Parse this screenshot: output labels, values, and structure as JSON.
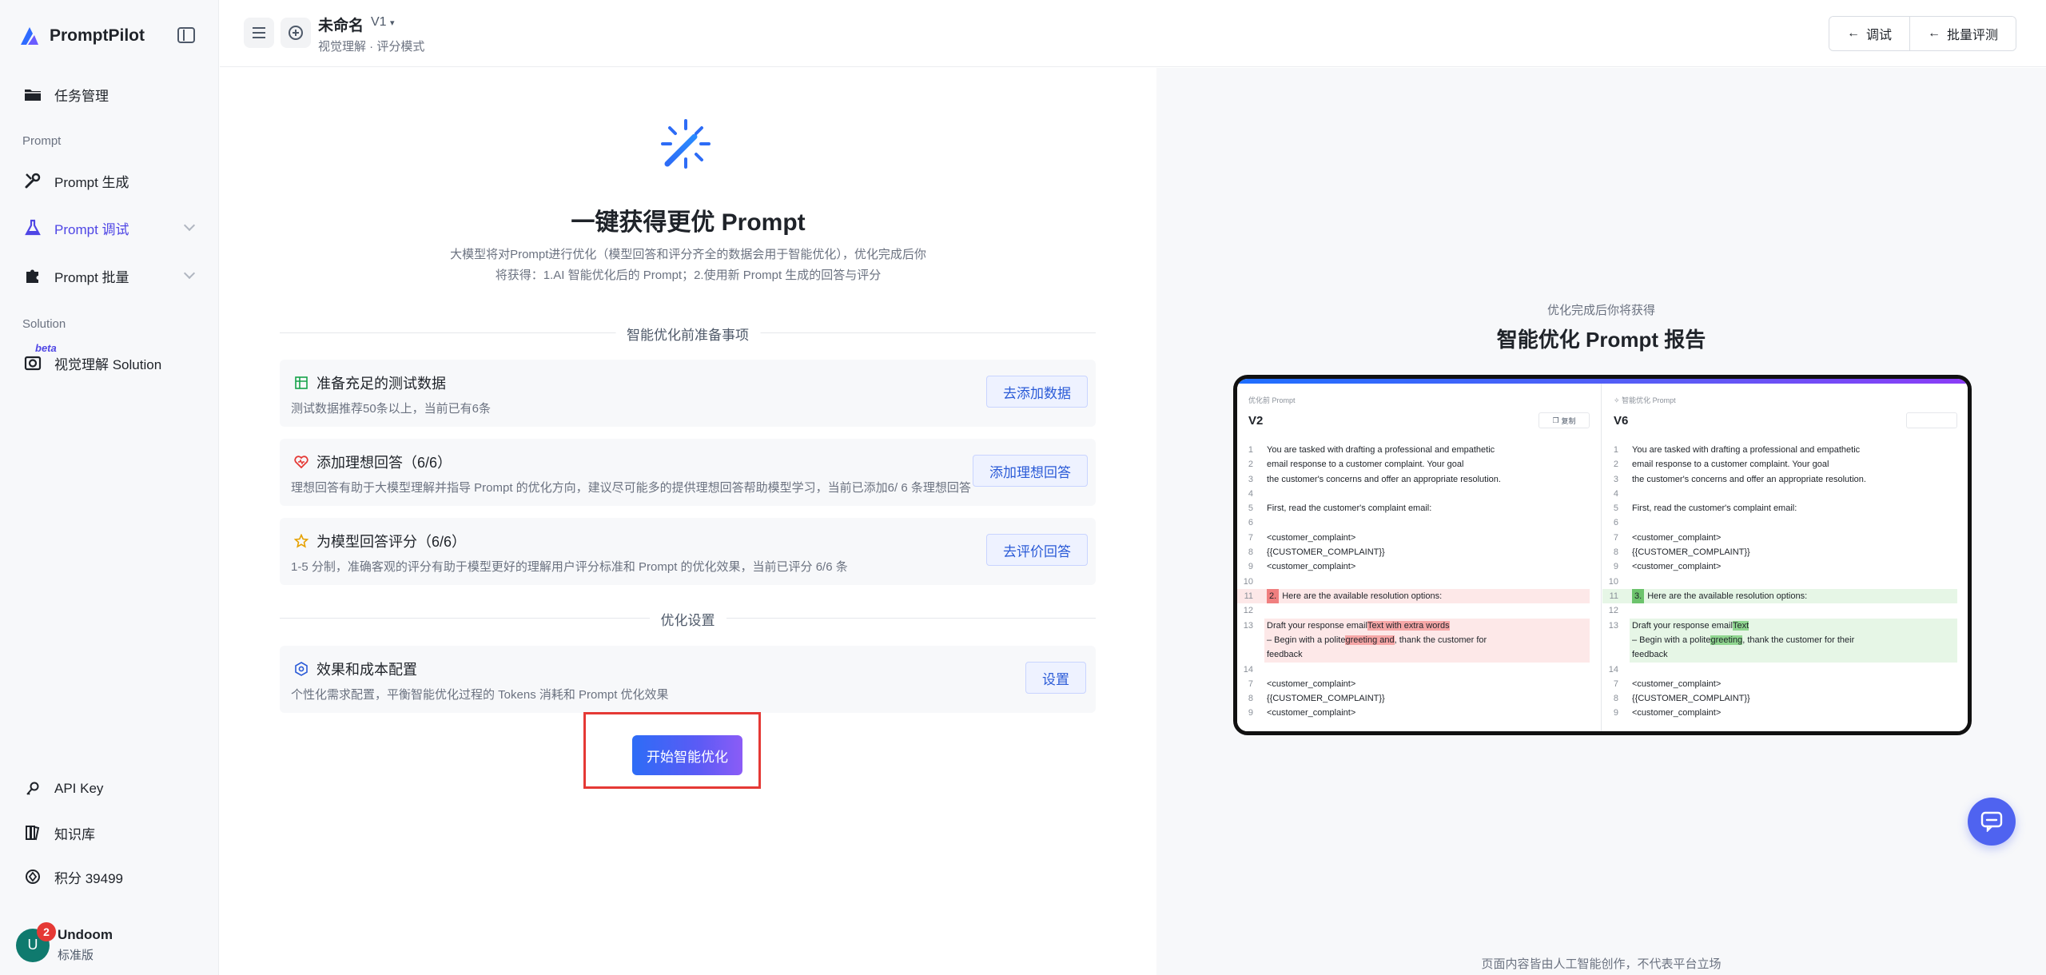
{
  "app": {
    "name": "PromptPilot"
  },
  "sidebar": {
    "items": [
      {
        "label": "任务管理"
      },
      {
        "label": "Prompt 生成"
      },
      {
        "label": "Prompt 调试"
      },
      {
        "label": "Prompt 批量"
      },
      {
        "label": "视觉理解 Solution"
      },
      {
        "label": "API Key"
      },
      {
        "label": "知识库"
      },
      {
        "label": "积分 39499"
      }
    ],
    "sections": {
      "prompt": "Prompt",
      "solution": "Solution"
    },
    "beta": "beta",
    "user": {
      "initial": "U",
      "badge": "2",
      "name": "Undoom",
      "plan": "标准版"
    }
  },
  "header": {
    "title": "未命名",
    "version": "V1",
    "subtitle": "视觉理解 · 评分模式",
    "buttons": {
      "debug": "调试",
      "batch": "批量评测"
    }
  },
  "main": {
    "heading": "一键获得更优 Prompt",
    "desc_line1": "大模型将对Prompt进行优化（模型回答和评分齐全的数据会用于智能优化），优化完成后你",
    "desc_line2": "将获得：1.AI 智能优化后的 Prompt；2.使用新 Prompt 生成的回答与评分",
    "prep_title": "智能优化前准备事项",
    "cards": [
      {
        "title": "准备充足的测试数据",
        "desc": "测试数据推荐50条以上，当前已有6条",
        "button": "去添加数据"
      },
      {
        "title": "添加理想回答（6/6）",
        "desc": "理想回答有助于大模型理解并指导 Prompt 的优化方向，建议尽可能多的提供理想回答帮助模型学习，当前已添加6/ 6 条理想回答",
        "button": "添加理想回答"
      },
      {
        "title": "为模型回答评分（6/6）",
        "desc": "1-5 分制，准确客观的评分有助于模型更好的理解用户评分标准和 Prompt 的优化效果，当前已评分 6/6 条",
        "button": "去评价回答"
      }
    ],
    "settings_title": "优化设置",
    "config": {
      "title": "效果和成本配置",
      "desc": "个性化需求配置，平衡智能优化过程的 Tokens 消耗和 Prompt 优化效果",
      "button": "设置"
    },
    "start_button": "开始智能优化"
  },
  "preview": {
    "subtitle": "优化完成后你将获得",
    "title": "智能优化 Prompt 报告",
    "left_label": "优化前 Prompt",
    "left_version": "V2",
    "copy": "复制",
    "right_label": "智能优化 Prompt",
    "right_version": "V6",
    "left_lines": [
      {
        "n": "1",
        "t": "You are tasked with drafting a professional and empathetic"
      },
      {
        "n": "2",
        "t": "email response to a customer complaint. Your goal"
      },
      {
        "n": "3",
        "t": "the customer's concerns and offer an appropriate resolution."
      },
      {
        "n": "4",
        "t": ""
      },
      {
        "n": "5",
        "t": "First, read the customer's complaint email:"
      },
      {
        "n": "6",
        "t": ""
      },
      {
        "n": "7",
        "t": "<customer_complaint>"
      },
      {
        "n": "8",
        "t": "{{CUSTOMER_COMPLAINT}}"
      },
      {
        "n": "9",
        "t": "<customer_complaint>"
      },
      {
        "n": "10",
        "t": ""
      },
      {
        "n": "11",
        "t": "Here are the available resolution options:",
        "box": "2."
      },
      {
        "n": "12",
        "t": ""
      }
    ],
    "left_block": {
      "n": "13",
      "l1a": "Draft your response email",
      "l1b": "Text with extra words",
      "l2a": "– Begin with a polite",
      "l2b": "greeting and",
      "l2c": ", thank the customer for",
      "l3": "feedback"
    },
    "left_tail": [
      {
        "n": "14",
        "t": ""
      },
      {
        "n": "7",
        "t": "<customer_complaint>"
      },
      {
        "n": "8",
        "t": "{{CUSTOMER_COMPLAINT}}"
      },
      {
        "n": "9",
        "t": "<customer_complaint>"
      }
    ],
    "right_lines": [
      {
        "n": "1",
        "t": "You are tasked with drafting a professional and empathetic"
      },
      {
        "n": "2",
        "t": "email response to a customer complaint. Your goal"
      },
      {
        "n": "3",
        "t": "the customer's concerns and offer an appropriate resolution."
      },
      {
        "n": "4",
        "t": ""
      },
      {
        "n": "5",
        "t": "First, read the customer's complaint email:"
      },
      {
        "n": "6",
        "t": ""
      },
      {
        "n": "7",
        "t": "<customer_complaint>"
      },
      {
        "n": "8",
        "t": "{{CUSTOMER_COMPLAINT}}"
      },
      {
        "n": "9",
        "t": "<customer_complaint>"
      },
      {
        "n": "10",
        "t": ""
      },
      {
        "n": "11",
        "t": "Here are the available resolution options:",
        "box": "3."
      },
      {
        "n": "12",
        "t": ""
      }
    ],
    "right_block": {
      "n": "13",
      "l1a": "Draft your response email",
      "l1b": "Text",
      "l2a": "– Begin with a polite",
      "l2b": "greeting",
      "l2c": ", thank the customer for their",
      "l3": "feedback"
    },
    "right_tail": [
      {
        "n": "14",
        "t": ""
      },
      {
        "n": "7",
        "t": "<customer_complaint>"
      },
      {
        "n": "8",
        "t": "{{CUSTOMER_COMPLAINT}}"
      },
      {
        "n": "9",
        "t": "<customer_complaint>"
      }
    ],
    "footer": "页面内容皆由人工智能创作，不代表平台立场"
  },
  "icons": {
    "logo": "promptpilot-logo-icon",
    "sidebar_toggle": "sidebar-toggle-icon",
    "tasks": "folder-icon",
    "generate": "tools-icon",
    "debug": "flask-icon",
    "batch": "puzzle-icon",
    "vision": "camera-icon",
    "api_key": "key-icon",
    "knowledge": "book-icon",
    "credits": "coin-icon",
    "menu": "menu-icon",
    "add": "plus-circle-icon",
    "back": "arrow-left-icon",
    "spark": "magic-spark-icon",
    "chat": "chat-icon"
  },
  "colors": {
    "accent": "#4f46e5",
    "primary_blue": "#2b5bd7",
    "highlight_red": "#e53935"
  }
}
